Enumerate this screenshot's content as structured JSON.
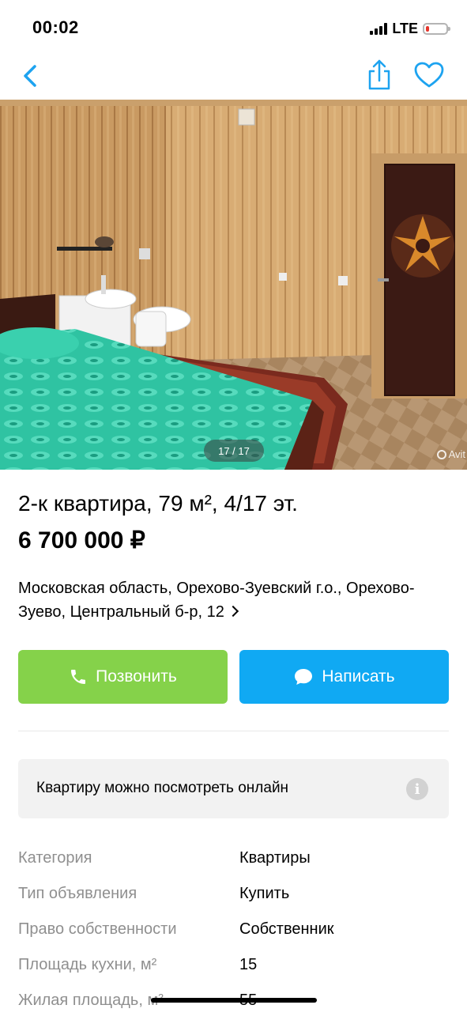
{
  "status_bar": {
    "time": "00:02",
    "network": "LTE",
    "battery_level": 0.15
  },
  "nav": {
    "back_icon": "chevron-left-icon",
    "share_icon": "share-icon",
    "favorite_icon": "heart-icon"
  },
  "gallery": {
    "counter": "17 / 17",
    "watermark": "Avit"
  },
  "listing": {
    "title": "2-к квартира, 79 м², 4/17 эт.",
    "price": "6 700 000 ₽",
    "address": "Московская область, Орехово-Зуевский г.о., Орехово-Зуево, Центральный б-р, 12"
  },
  "actions": {
    "call_label": "Позвонить",
    "message_label": "Написать"
  },
  "online_view": {
    "text": "Квартиру можно посмотреть онлайн",
    "icon": "info-icon"
  },
  "params": [
    {
      "key": "Категория",
      "value": "Квартиры"
    },
    {
      "key": "Тип объявления",
      "value": "Купить"
    },
    {
      "key": "Право собственности",
      "value": "Собственник"
    },
    {
      "key": "Площадь кухни, м²",
      "value": "15"
    },
    {
      "key": "Жилая площадь, м²",
      "value": "55"
    }
  ],
  "colors": {
    "accent_blue": "#10a9f3",
    "call_green": "#85d24a",
    "nav_icon": "#1da3f0"
  }
}
